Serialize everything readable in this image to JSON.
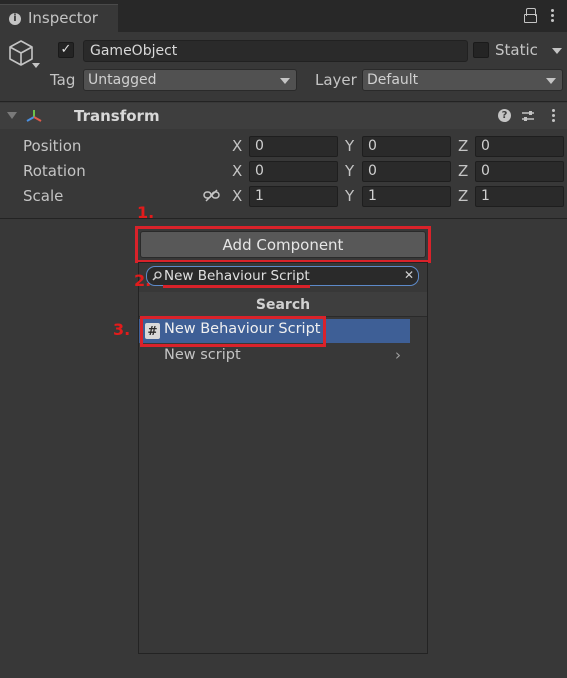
{
  "tab": {
    "title": "Inspector"
  },
  "header": {
    "object_name": "GameObject",
    "static_label": "Static",
    "tag_label": "Tag",
    "tag_value": "Untagged",
    "layer_label": "Layer",
    "layer_value": "Default"
  },
  "transform": {
    "title": "Transform",
    "rows": [
      {
        "label": "Position",
        "x": "0",
        "y": "0",
        "z": "0"
      },
      {
        "label": "Rotation",
        "x": "0",
        "y": "0",
        "z": "0"
      },
      {
        "label": "Scale",
        "x": "1",
        "y": "1",
        "z": "1"
      }
    ],
    "axes": {
      "x": "X",
      "y": "Y",
      "z": "Z"
    }
  },
  "add_component": {
    "button_label": "Add Component",
    "search_value": "New Behaviour Script",
    "section_title": "Search",
    "items": [
      {
        "label": "New Behaviour Script"
      },
      {
        "label": "New script"
      }
    ]
  },
  "annotations": {
    "step1": "1.",
    "step2": "2.",
    "step3": "3."
  },
  "colors": {
    "highlight_red": "#d9222a",
    "selection_blue": "#3e5f96"
  },
  "icons": [
    "info-icon",
    "lock-icon",
    "kebab-menu-icon",
    "cube-icon",
    "transform-axes-icon",
    "help-icon",
    "preset-icon",
    "constrain-link-icon",
    "search-icon",
    "clear-icon",
    "script-hash-icon",
    "chevron-right-icon"
  ]
}
